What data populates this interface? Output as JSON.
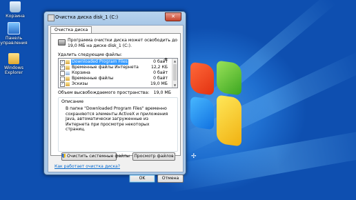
{
  "desktop": {
    "icons": [
      {
        "label": "Корзина",
        "icon": "recycle-bin-icon"
      },
      {
        "label": "Панель управления",
        "icon": "control-panel-icon"
      },
      {
        "label": "Windows Explorer",
        "icon": "windows-explorer-icon"
      }
    ]
  },
  "window": {
    "title": "Очистка диска disk_1 (C:)",
    "close_label": "✕",
    "tab_label": "Очистка диска",
    "info_text": "Программа очистки диска может освободить до 19,0 МБ на диске disk_1 (C:).",
    "delete_label": "Удалить следующие файлы:",
    "files": [
      {
        "name": "Downloaded Program Files",
        "size": "0 байт",
        "checked": true,
        "selected": true
      },
      {
        "name": "Временные файлы Интернета",
        "size": "12,2 КБ",
        "checked": true,
        "selected": false
      },
      {
        "name": "Корзина",
        "size": "0 байт",
        "checked": false,
        "selected": false
      },
      {
        "name": "Временные файлы",
        "size": "0 байт",
        "checked": false,
        "selected": false
      },
      {
        "name": "Эскизы",
        "size": "19,0 МБ",
        "checked": true,
        "selected": false
      }
    ],
    "total_label": "Объем высвобождаемого пространства:",
    "total_value": "19,0 МБ",
    "description_title": "Описание",
    "description_text": "В папке \"Downloaded Program Files\" временно сохраняются элементы ActiveX и приложения Java, автоматически загруженные из Интернета при просмотре некоторых страниц.",
    "clean_system_label": "Очистить системные файлы",
    "view_files_label": "Просмотр файлов",
    "help_link": "Как работает очистка диска?",
    "ok_label": "OK",
    "cancel_label": "Отмена"
  }
}
